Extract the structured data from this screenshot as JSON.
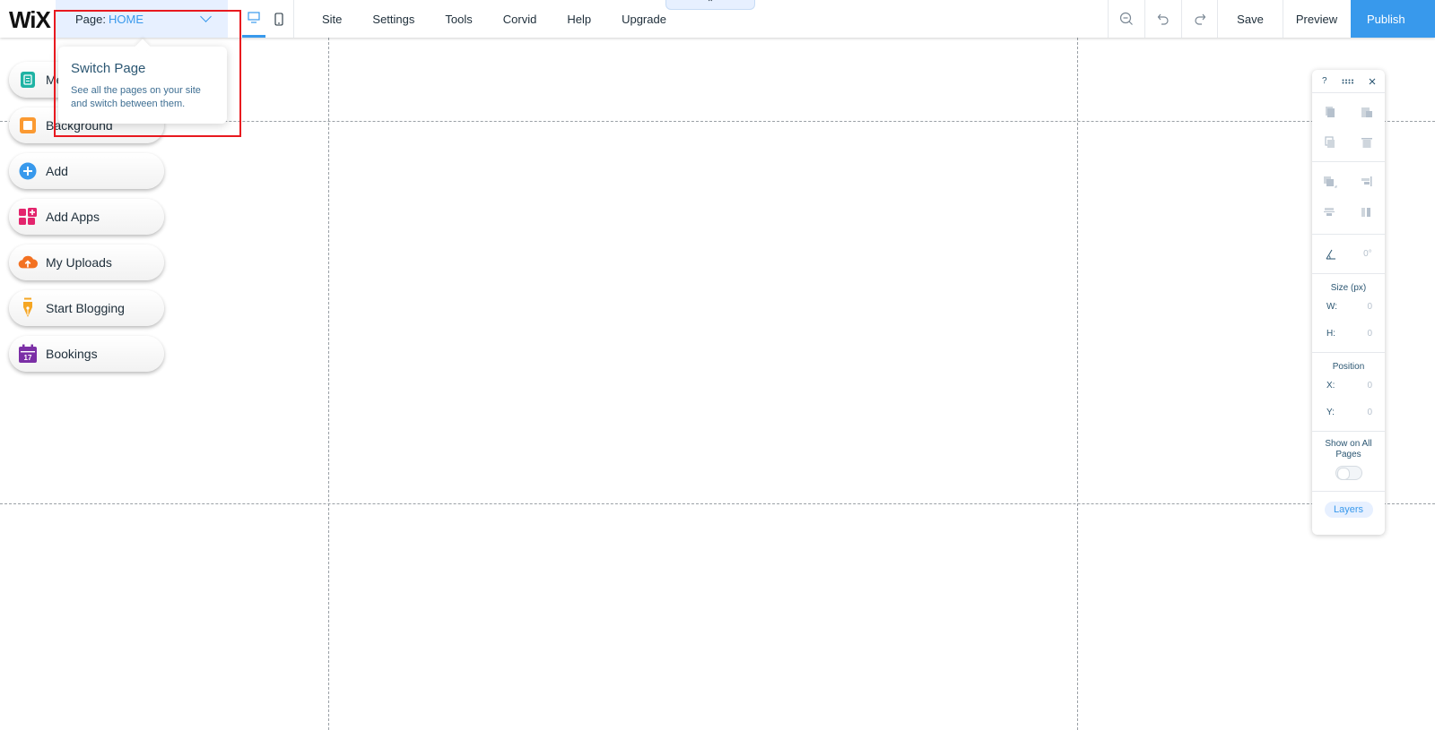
{
  "brand": {
    "logo_text": "WiX"
  },
  "page_selector": {
    "label": "Page:",
    "value": "HOME"
  },
  "menu": [
    "Site",
    "Settings",
    "Tools",
    "Corvid",
    "Help",
    "Upgrade"
  ],
  "collapse_glyph": "⌃",
  "actions": {
    "save": "Save",
    "preview": "Preview",
    "publish": "Publish"
  },
  "left_panel": [
    {
      "label": "Menus",
      "icon": "pages-icon"
    },
    {
      "label": "Background",
      "icon": "background-icon"
    },
    {
      "label": "Add",
      "icon": "add-icon"
    },
    {
      "label": "Add Apps",
      "icon": "apps-icon"
    },
    {
      "label": "My Uploads",
      "icon": "upload-cloud-icon"
    },
    {
      "label": "Start Blogging",
      "icon": "pen-nib-icon"
    },
    {
      "label": "Bookings",
      "icon": "calendar-icon"
    }
  ],
  "tooltip": {
    "title": "Switch Page",
    "body": "See all the pages on your site and switch between them."
  },
  "right_panel": {
    "help": "?",
    "rotation": "0°",
    "size_label": "Size (px)",
    "w_label": "W:",
    "w_value": "0",
    "h_label": "H:",
    "h_value": "0",
    "position_label": "Position",
    "x_label": "X:",
    "x_value": "0",
    "y_label": "Y:",
    "y_value": "0",
    "show_all_label": "Show on All Pages",
    "layers": "Layers"
  },
  "colors": {
    "accent": "#3899ec",
    "highlight": "#e8191f",
    "text": "#20303c"
  }
}
